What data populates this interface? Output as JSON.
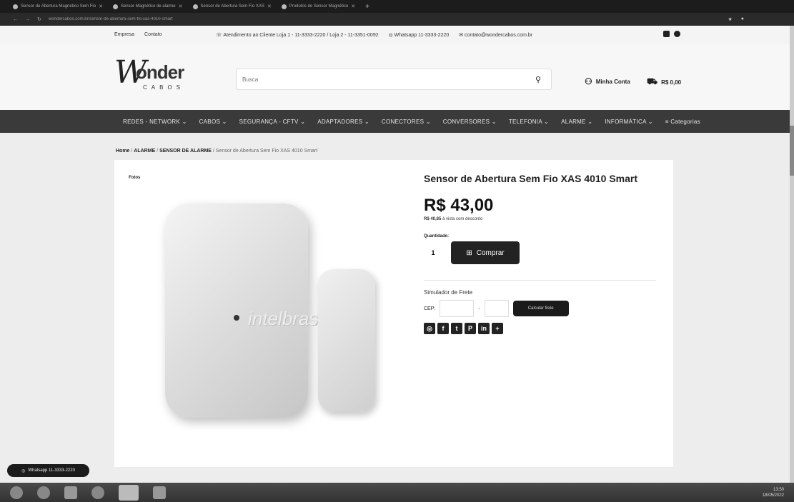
{
  "browser": {
    "tabs": [
      {
        "label": "Sensor de Abertura Magnético Sem Fio"
      },
      {
        "label": "Sensor Magnético de alarme"
      },
      {
        "label": "Sensor de Abertura Sem Fio XAS"
      },
      {
        "label": "Produtos de Sensor Magnético"
      }
    ],
    "url": "wondercabos.com.br/sensor-de-abertura-sem-fio-xas-4010-smart"
  },
  "topbar": {
    "links": [
      "Empresa",
      "Contato"
    ],
    "phone": "Atendimento ao Cliente Loja 1 - 11-3333-2220 / Loja 2 - 11-3351-0092",
    "whatsapp": "Whatsapp 11-3333-2220",
    "email": "contato@wondercabos.com.br"
  },
  "header": {
    "logo_main": "onder",
    "logo_sub": "CABOS",
    "search_placeholder": "Busca",
    "account_label": "Minha Conta",
    "cart_label": "R$ 0,00"
  },
  "nav": {
    "items": [
      "REDES - NETWORK ⌄",
      "CABOS ⌄",
      "SEGURANÇA - CFTV ⌄",
      "ADAPTADORES ⌄",
      "CONECTORES ⌄",
      "CONVERSORES ⌄",
      "TELEFONIA ⌄",
      "ALARME ⌄",
      "INFORMÁTICA ⌄",
      "Categorias"
    ]
  },
  "breadcrumb": {
    "home": "Home",
    "cat1": "ALARME",
    "cat2": "SENSOR DE ALARME",
    "current": "Sensor de Abertura Sem Fio XAS 4010 Smart"
  },
  "product": {
    "photos_label": "Fotos",
    "brand_on_image": "intelbras",
    "title": "Sensor de Abertura Sem Fio XAS 4010 Smart",
    "price": "R$ 43,00",
    "cash_price": "R$ 40,85",
    "cash_suffix": "à vista com desconto",
    "qty_label": "Quantidade:",
    "qty_value": "1",
    "buy_label": "Comprar",
    "frete_label": "Simulador de Frete",
    "cep_label": "CEP:",
    "calc_label": "Calcular frete",
    "share_icons": [
      "whatsapp-icon",
      "facebook-icon",
      "twitter-icon",
      "pinterest-icon",
      "linkedin-icon",
      "plus-icon"
    ]
  },
  "whatsapp_float": "Whatsapp 11-3333-2220",
  "taskbar": {
    "time": "13:50",
    "date": "18/05/2022"
  }
}
